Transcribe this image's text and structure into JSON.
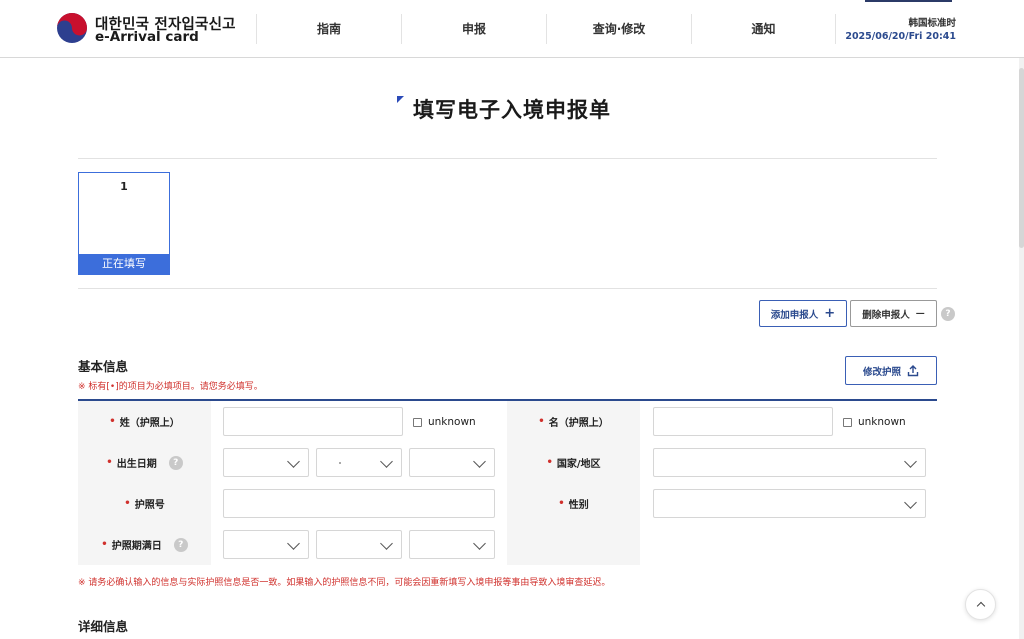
{
  "header": {
    "logo_kr": "대한민국 전자입국신고",
    "logo_en": "e-Arrival card",
    "nav": [
      {
        "label": "指南"
      },
      {
        "label": "申报"
      },
      {
        "label": "查询·修改"
      },
      {
        "label": "通知"
      }
    ],
    "time_label": "韩国标准时",
    "time_value": "2025/06/20/Fri 20:41"
  },
  "page_title": "填写电子入境申报单",
  "applicant": {
    "number": "1",
    "status": "正在填写"
  },
  "actions": {
    "add_label": "添加申报人",
    "add_icon": "+",
    "delete_label": "删除申报人",
    "delete_icon": "—",
    "help_icon": "?"
  },
  "basic_info": {
    "title": "基本信息",
    "note": "※ 标有[•]的项目为必填项目。请您务必填写。",
    "edit_passport_label": "修改护照",
    "fields": {
      "surname_label": "姓（护照上）",
      "given_name_label": "名（护照上）",
      "unknown_label": "unknown",
      "birth_label": "出生日期",
      "country_label": "国家/地区",
      "passport_no_label": "护照号",
      "gender_label": "性别",
      "expiry_label": "护照期满日"
    },
    "required_mark": "•"
  },
  "warning": "※ 请务必确认输入的信息与实际护照信息是否一致。如果输入的护照信息不同，可能会因重新填写入境申报等事由导致入境审查延迟。",
  "detail_title": "详细信息",
  "colors": {
    "primary": "#3c6edb",
    "navy": "#2b4a8e",
    "required": "#d0312d"
  }
}
